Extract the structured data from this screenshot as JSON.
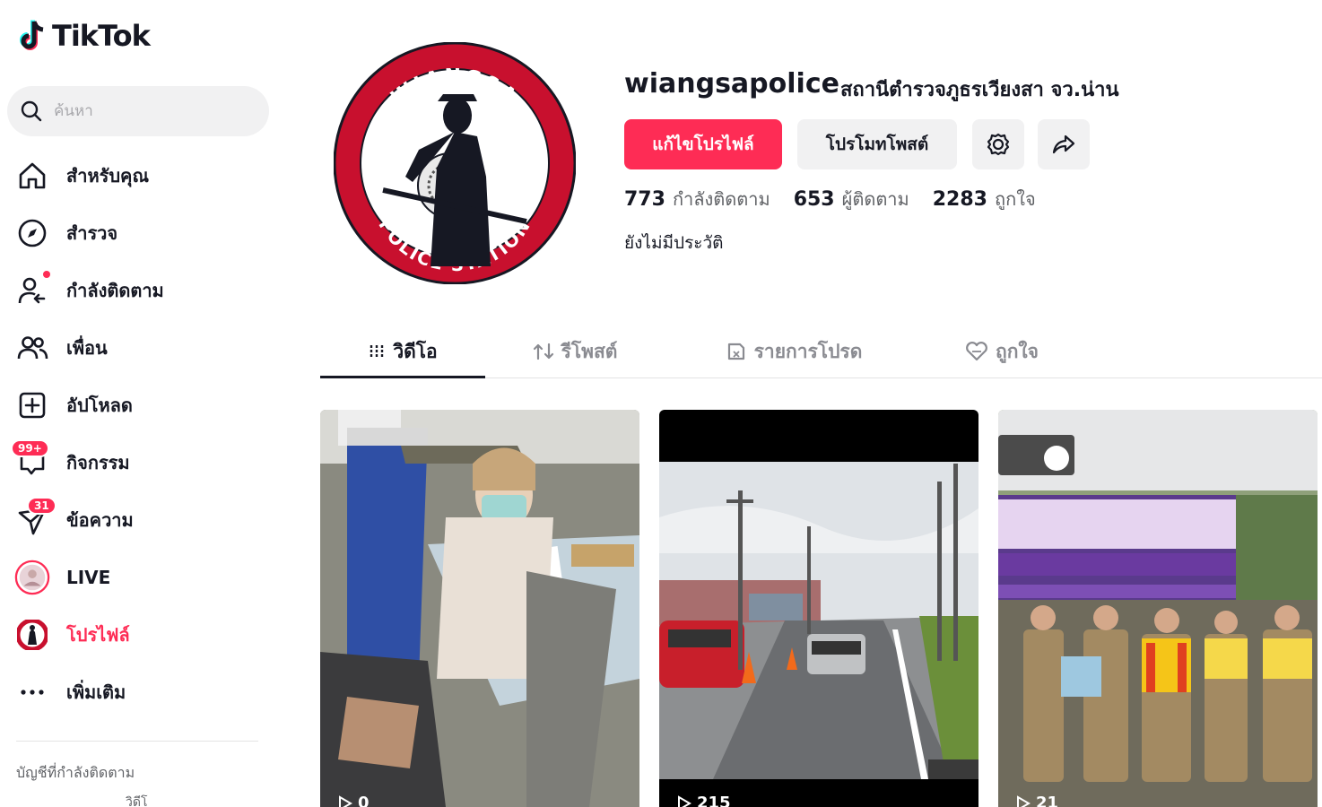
{
  "brand": {
    "name": "TikTok"
  },
  "search": {
    "placeholder": "ค้นหา"
  },
  "sidebar": {
    "items": [
      {
        "label": "สำหรับคุณ",
        "icon": "home-icon"
      },
      {
        "label": "สำรวจ",
        "icon": "compass-icon"
      },
      {
        "label": "กำลังติดตาม",
        "icon": "following-icon"
      },
      {
        "label": "เพื่อน",
        "icon": "friends-icon"
      },
      {
        "label": "อัปโหลด",
        "icon": "upload-icon"
      },
      {
        "label": "กิจกรรม",
        "icon": "activity-icon",
        "badge": "99+"
      },
      {
        "label": "ข้อความ",
        "icon": "messages-icon",
        "badge": "31"
      },
      {
        "label": "LIVE",
        "icon": "live-icon"
      },
      {
        "label": "โปรไฟล์",
        "icon": "profile-avatar-icon",
        "active": true
      },
      {
        "label": "เพิ่มเติม",
        "icon": "more-icon"
      }
    ],
    "following_title": "บัญชีที่กำลังติดตาม",
    "following_sub": "วิดีโ"
  },
  "profile": {
    "username": "wiangsapolice",
    "nickname": "สถานีตำรวจภูธรเวียงสา จว.น่าน",
    "edit_label": "แก้ไขโปรไฟล์",
    "promote_label": "โปรโมทโพสต์",
    "stats": {
      "following_count": "773",
      "following_label": "กำลังติดตาม",
      "followers_count": "653",
      "followers_label": "ผู้ติดตาม",
      "likes_count": "2283",
      "likes_label": "ถูกใจ"
    },
    "bio": "ยังไม่มีประวัติ",
    "avatar_text": {
      "top": "WIANGSA",
      "bottom": "POLICE STATION"
    }
  },
  "tabs": [
    {
      "label": "วิดีโอ",
      "icon": "grid-icon",
      "active": true
    },
    {
      "label": "รีโพสต์",
      "icon": "repost-icon"
    },
    {
      "label": "รายการโปรด",
      "icon": "bookmark-icon"
    },
    {
      "label": "ถูกใจ",
      "icon": "heart-icon"
    }
  ],
  "videos": [
    {
      "views": "0"
    },
    {
      "views": "215"
    },
    {
      "views": "21"
    }
  ],
  "colors": {
    "accent": "#fe2c55",
    "text": "#161823",
    "muted": "#606266",
    "surface": "#f1f1f2"
  }
}
